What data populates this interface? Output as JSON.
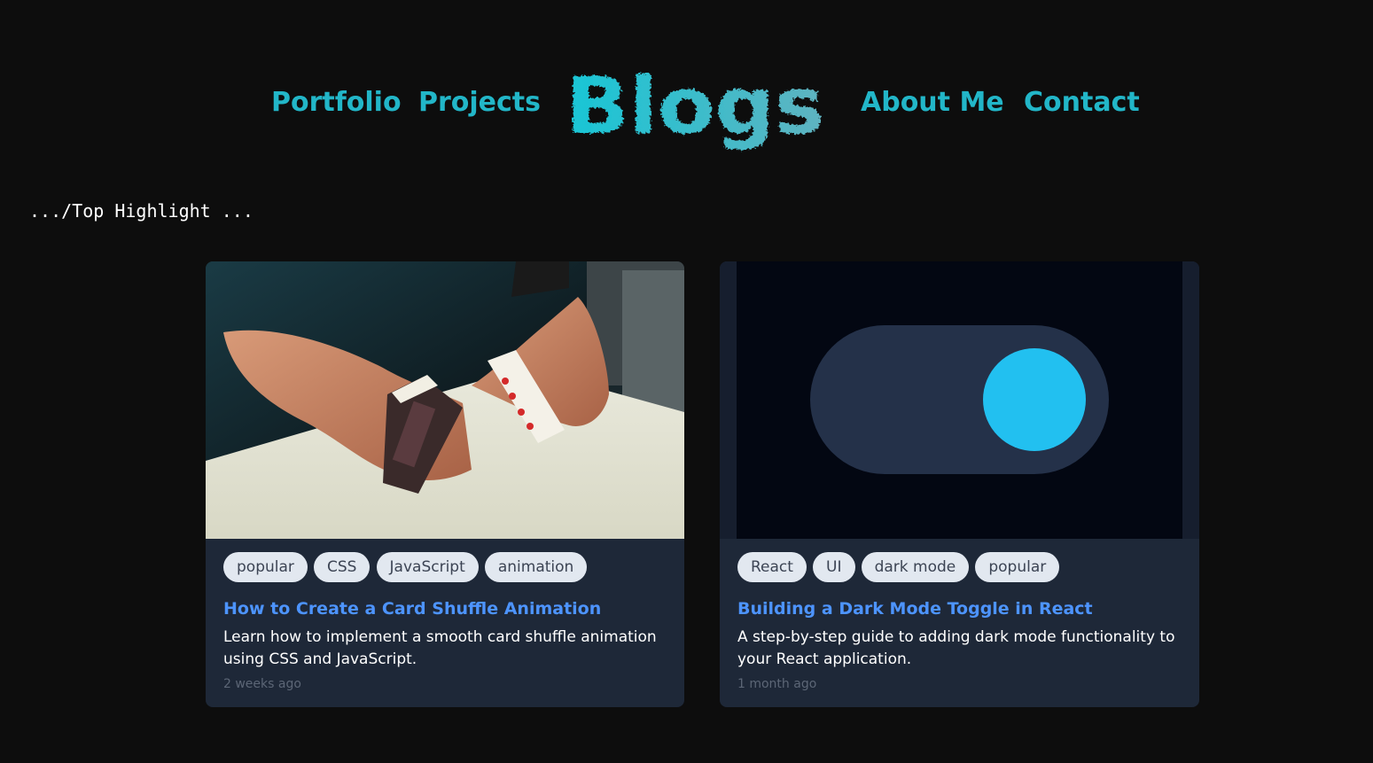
{
  "nav": {
    "items": [
      {
        "label": "Portfolio"
      },
      {
        "label": "Projects"
      },
      {
        "label": "About Me"
      },
      {
        "label": "Contact"
      }
    ],
    "logo_text": "Blogs"
  },
  "section": {
    "heading": ".../Top Highlight ..."
  },
  "cards": [
    {
      "tags": [
        "popular",
        "CSS",
        "JavaScript",
        "animation"
      ],
      "title": "How to Create a Card Shuffle Animation",
      "description": "Learn how to implement a smooth card shuffle animation using CSS and JavaScript.",
      "time": "2 weeks ago"
    },
    {
      "tags": [
        "React",
        "UI",
        "dark mode",
        "popular"
      ],
      "title": "Building a Dark Mode Toggle in React",
      "description": "A step-by-step guide to adding dark mode functionality to your React application.",
      "time": "1 month ago"
    }
  ],
  "colors": {
    "background": "#0d0d0d",
    "accent": "#22b6c8",
    "card_bg": "#1e2838",
    "title_link": "#4d94ff",
    "tag_bg": "#e2e8f0",
    "toggle_knob": "#22c0f0"
  }
}
